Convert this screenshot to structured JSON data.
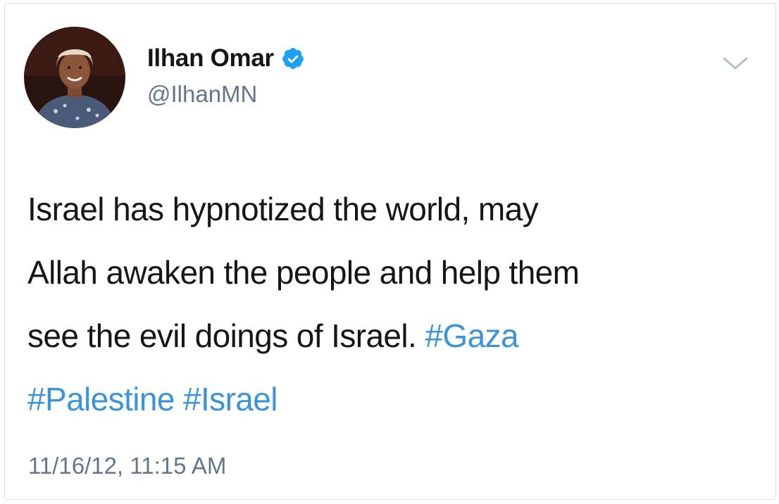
{
  "tweet": {
    "display_name": "Ilhan Omar",
    "handle": "@IlhanMN",
    "verified": true,
    "text": {
      "line1": "Israel has hypnotized the world, may",
      "line2": "Allah awaken the people and help them",
      "line3_prefix": "see the evil doings of Israel.",
      "hashtag_gaza": "#Gaza",
      "hashtag_palestine": "#Palestine",
      "hashtag_israel": "#Israel"
    },
    "timestamp": "11/16/12, 11:15 AM"
  },
  "icons": {
    "verified_badge": "verified-badge-icon",
    "menu": "chevron-down-icon"
  },
  "colors": {
    "text": "#14171a",
    "secondary": "#657786",
    "hashtag": "#3b94d9",
    "verified": "#1da1f2"
  }
}
